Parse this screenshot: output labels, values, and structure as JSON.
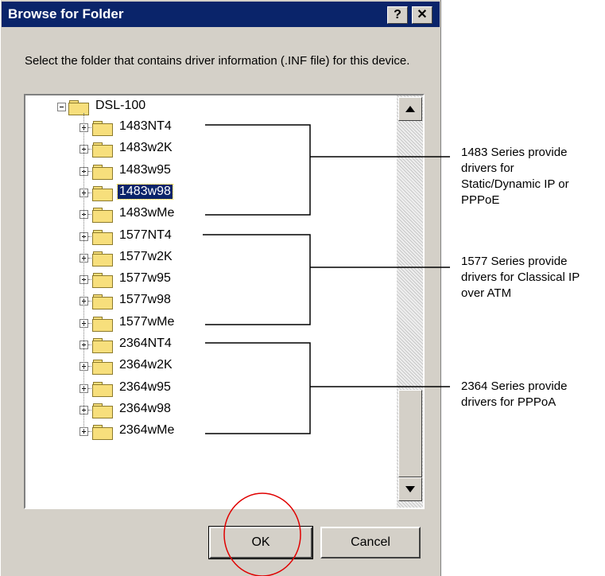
{
  "dialog": {
    "title": "Browse for Folder",
    "help_label": "?",
    "close_label": "✕",
    "prompt": "Select the folder that contains driver information (.INF file) for this device."
  },
  "tree": {
    "root": "DSL-100",
    "items": [
      {
        "label": "1483NT4",
        "selected": false
      },
      {
        "label": "1483w2K",
        "selected": false
      },
      {
        "label": "1483w95",
        "selected": false
      },
      {
        "label": "1483w98",
        "selected": true
      },
      {
        "label": "1483wMe",
        "selected": false
      },
      {
        "label": "1577NT4",
        "selected": false
      },
      {
        "label": "1577w2K",
        "selected": false
      },
      {
        "label": "1577w95",
        "selected": false
      },
      {
        "label": "1577w98",
        "selected": false
      },
      {
        "label": "1577wMe",
        "selected": false
      },
      {
        "label": "2364NT4",
        "selected": false
      },
      {
        "label": "2364w2K",
        "selected": false
      },
      {
        "label": "2364w95",
        "selected": false
      },
      {
        "label": "2364w98",
        "selected": false
      },
      {
        "label": "2364wMe",
        "selected": false
      }
    ]
  },
  "buttons": {
    "ok": "OK",
    "cancel": "Cancel"
  },
  "annotations": [
    {
      "lines": [
        "1483 Series provide",
        "drivers for",
        "Static/Dynamic IP or",
        "PPPoE"
      ]
    },
    {
      "lines": [
        "1577 Series provide",
        "drivers for Classical IP",
        "over ATM"
      ]
    },
    {
      "lines": [
        "2364 Series provide",
        "drivers for PPPoA"
      ]
    }
  ],
  "colors": {
    "titlebar": "#0a246a",
    "dialog_bg": "#d4d0c8",
    "highlight_circle": "#e00000"
  }
}
